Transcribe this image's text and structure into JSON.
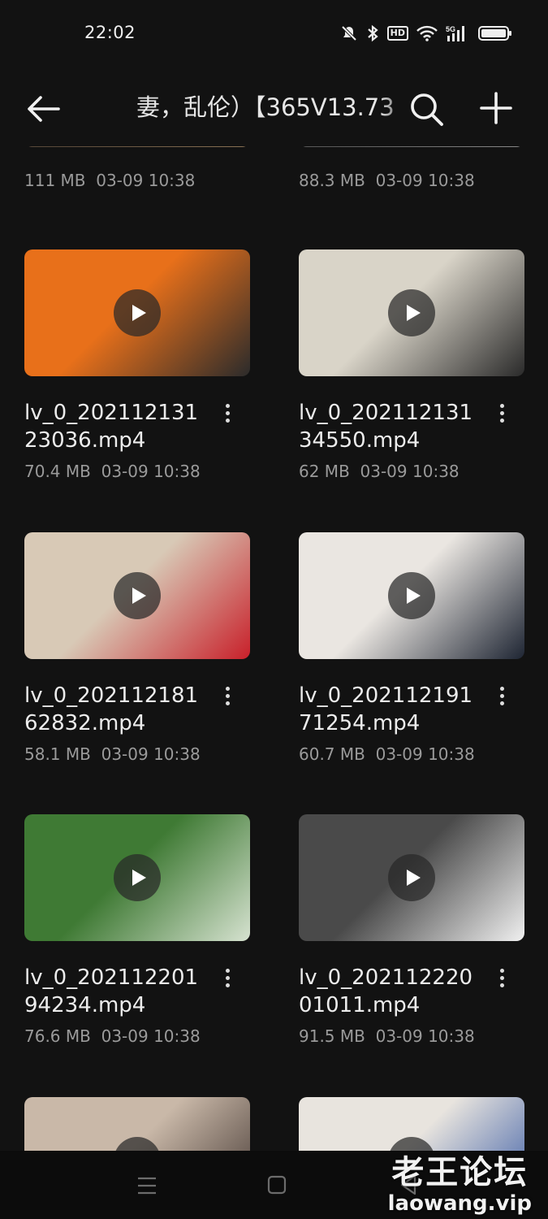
{
  "status_bar": {
    "time": "22:02",
    "icons": [
      "mute-icon",
      "bluetooth-icon",
      "hd-icon",
      "wifi-icon",
      "5g-signal-icon",
      "battery-icon"
    ],
    "hd_label": "HD",
    "net_label": "5G"
  },
  "header": {
    "title": "妻，乱伦）【365V13.73",
    "icons": [
      "back-arrow-icon",
      "search-icon",
      "plus-icon"
    ]
  },
  "files": [
    {
      "name": "",
      "size": "111 MB",
      "date": "03-09",
      "time": "10:38",
      "thumb": [
        "#5a4a3a",
        "#8b7355"
      ]
    },
    {
      "name": "",
      "size": "88.3 MB",
      "date": "03-09",
      "time": "10:38",
      "thumb": [
        "#5a5a5a",
        "#8a8a8a"
      ]
    },
    {
      "name": "lv_0_20211213123036.mp4",
      "size": "70.4 MB",
      "date": "03-09",
      "time": "10:38",
      "thumb": [
        "#e8701a",
        "#2b2b2b"
      ]
    },
    {
      "name": "lv_0_20211213134550.mp4",
      "size": "62 MB",
      "date": "03-09",
      "time": "10:38",
      "thumb": [
        "#d9d4c8",
        "#2a2a2a"
      ]
    },
    {
      "name": "lv_0_20211218162832.mp4",
      "size": "58.1 MB",
      "date": "03-09",
      "time": "10:38",
      "thumb": [
        "#d8c9b6",
        "#c8202a"
      ]
    },
    {
      "name": "lv_0_20211219171254.mp4",
      "size": "60.7 MB",
      "date": "03-09",
      "time": "10:38",
      "thumb": [
        "#eae6e1",
        "#1e2533"
      ]
    },
    {
      "name": "lv_0_20211220194234.mp4",
      "size": "76.6 MB",
      "date": "03-09",
      "time": "10:38",
      "thumb": [
        "#3f7a34",
        "#d6e2d0"
      ]
    },
    {
      "name": "lv_0_20211222001011.mp4",
      "size": "91.5 MB",
      "date": "03-09",
      "time": "10:38",
      "thumb": [
        "#4a4a4a",
        "#f0f0f0"
      ]
    },
    {
      "name": "",
      "size": "",
      "date": "",
      "time": "",
      "thumb": [
        "#c9b8a8",
        "#3a2e2a"
      ]
    },
    {
      "name": "",
      "size": "",
      "date": "",
      "time": "",
      "thumb": [
        "#e8e4de",
        "#2a4fa0"
      ]
    }
  ],
  "nav_bar": {
    "icons": [
      "menu-icon",
      "home-icon",
      "back-triangle-icon"
    ]
  },
  "watermark": {
    "cn": "老王论坛",
    "en": "laowang.vip"
  },
  "colors": {
    "background": "#121212",
    "text_primary": "#ececec",
    "text_secondary": "#9a9a9a"
  }
}
